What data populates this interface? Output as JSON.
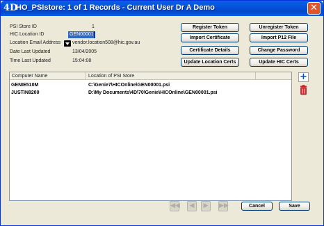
{
  "window": {
    "icon_glyph": "4D",
    "title": "HO_PSIstore: 1 of 1 Records - Current User Dr A Demo",
    "close_glyph": "✕"
  },
  "form": {
    "psi_store_id_label": "PSI Store ID",
    "psi_store_id_value": "1",
    "hic_location_id_label": "HIC Location ID",
    "hic_location_id_value": "GEN00001",
    "location_email_label": "Location Email Address",
    "location_email_value": "vendor.location508@hic.gov.au",
    "date_last_updated_label": "Date Last Updated",
    "date_last_updated_value": "13/04/2005",
    "time_last_updated_label": "Time Last Updated",
    "time_last_updated_value": "15:04:08"
  },
  "buttons": {
    "register_token": "Register Token",
    "unregister_token": "Unregister Token",
    "import_certificate": "Import Certificate",
    "import_p12": "Import P12 File",
    "certificate_details": "Certificate Details",
    "change_password": "Change Password",
    "update_location_certs": "Update Location Certs",
    "update_hic_certs": "Update HIC Certs",
    "cancel": "Cancel",
    "save": "Save"
  },
  "table": {
    "columns": [
      "Computer Name",
      "Location of PSI Store"
    ],
    "rows": [
      {
        "computer": "GENIE510M",
        "location": "C:\\Genie7\\HICOnline\\GEN00001.psi"
      },
      {
        "computer": "JUSTIN8200",
        "location": "D:\\My Documents\\4D\\70\\Genie\\HICOnline\\GEN00001.psi"
      }
    ]
  },
  "icons": {
    "add": "+",
    "first": "◀◀",
    "prev": "◀",
    "next": "▶",
    "last": "▶▶"
  },
  "colors": {
    "title_bar": "#0451d9",
    "selection": "#316ac5",
    "close": "#e2542b"
  }
}
